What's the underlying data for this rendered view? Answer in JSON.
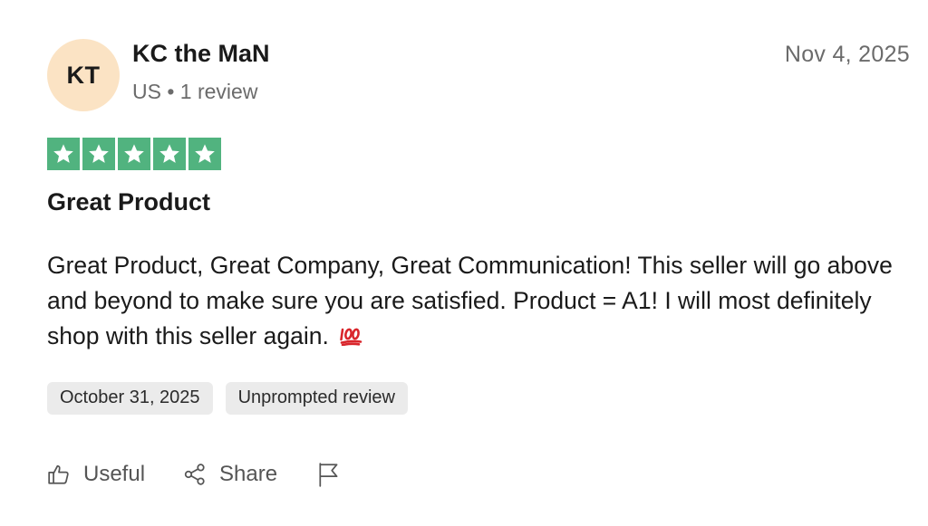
{
  "reviewer": {
    "initials": "KT",
    "name": "KC the MaN",
    "country": "US",
    "separator": "•",
    "review_count": "1 review",
    "avatar_color": "#fbe3c4"
  },
  "review": {
    "posted_date": "Nov 4, 2025",
    "rating": 5,
    "max_rating": 5,
    "star_color": "#51b37f",
    "title": "Great Product",
    "body": "Great Product, Great Company, Great Communication! This seller will go above and beyond to make sure you are satisfied. Product = A1! I will most definitely shop with this seller again.",
    "body_emoji": "hundred-points-icon",
    "experience_date": "October 31, 2025",
    "source_tag": "Unprompted review"
  },
  "actions": {
    "useful_label": "Useful",
    "useful_icon": "thumbs-up-icon",
    "share_label": "Share",
    "share_icon": "share-icon",
    "report_icon": "flag-icon"
  }
}
